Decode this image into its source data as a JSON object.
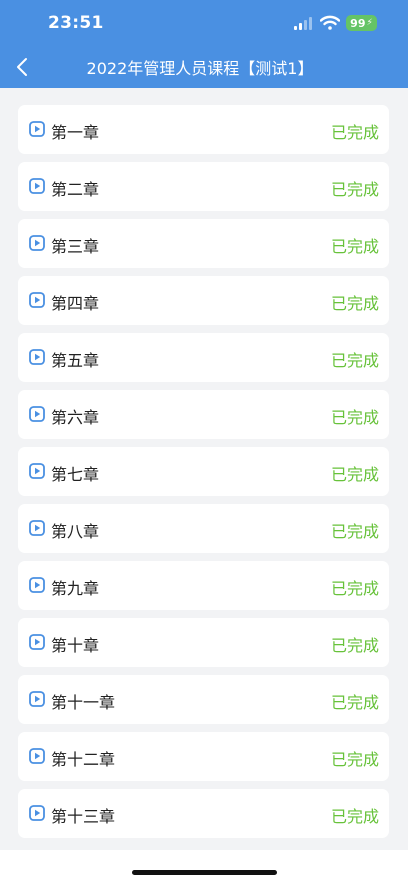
{
  "status_bar": {
    "time": "23:51",
    "battery": "99"
  },
  "header": {
    "title": "2022年管理人员课程【测试1】",
    "back_icon": "chevron-left-icon"
  },
  "chapters": [
    {
      "title": "第一章",
      "status": "已完成"
    },
    {
      "title": "第二章",
      "status": "已完成"
    },
    {
      "title": "第三章",
      "status": "已完成"
    },
    {
      "title": "第四章",
      "status": "已完成"
    },
    {
      "title": "第五章",
      "status": "已完成"
    },
    {
      "title": "第六章",
      "status": "已完成"
    },
    {
      "title": "第七章",
      "status": "已完成"
    },
    {
      "title": "第八章",
      "status": "已完成"
    },
    {
      "title": "第九章",
      "status": "已完成"
    },
    {
      "title": "第十章",
      "status": "已完成"
    },
    {
      "title": "第十一章",
      "status": "已完成"
    },
    {
      "title": "第十二章",
      "status": "已完成"
    },
    {
      "title": "第十三章",
      "status": "已完成"
    }
  ],
  "colors": {
    "header_bg": "#4a90e2",
    "page_bg": "#f2f3f5",
    "status_done": "#67c23a",
    "play_icon": "#4a90e2",
    "battery": "#65c466"
  }
}
